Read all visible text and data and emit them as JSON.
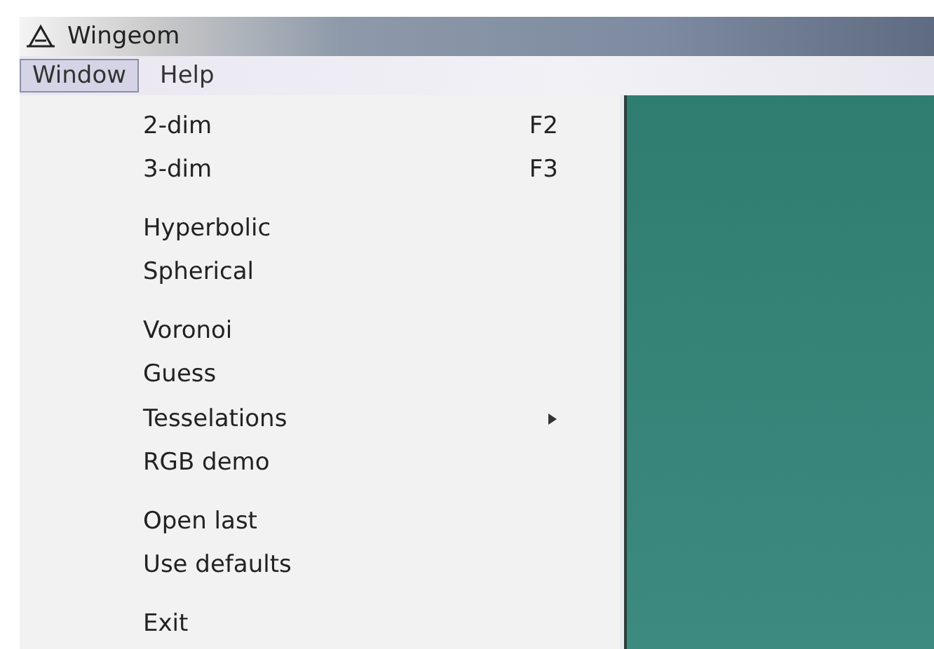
{
  "window": {
    "title": "Wingeom"
  },
  "menubar": [
    {
      "label": "Window",
      "selected": true
    },
    {
      "label": "Help",
      "selected": false
    }
  ],
  "menu": {
    "groups": [
      [
        {
          "label": "2-dim",
          "shortcut": "F2",
          "submenu": false
        },
        {
          "label": "3-dim",
          "shortcut": "F3",
          "submenu": false
        }
      ],
      [
        {
          "label": "Hyperbolic",
          "submenu": false
        },
        {
          "label": "Spherical",
          "submenu": false
        }
      ],
      [
        {
          "label": "Voronoi",
          "submenu": false
        },
        {
          "label": "Guess",
          "submenu": false
        },
        {
          "label": "Tesselations",
          "submenu": true
        },
        {
          "label": "RGB demo",
          "submenu": false
        }
      ],
      [
        {
          "label": "Open last",
          "submenu": false
        },
        {
          "label": "Use defaults",
          "submenu": false
        }
      ],
      [
        {
          "label": "Exit",
          "submenu": false
        }
      ]
    ]
  }
}
